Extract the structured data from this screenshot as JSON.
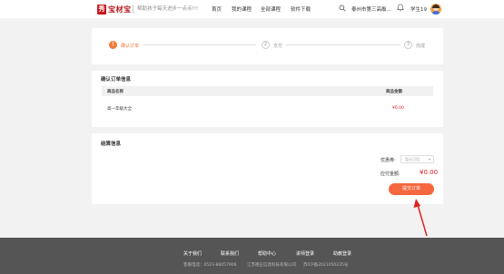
{
  "header": {
    "logo_mark": "秀",
    "logo_text": "宝材宝",
    "slogan": "帮助孩子每天进步一点点!!!",
    "nav": [
      "首页",
      "我的课程",
      "全部课程",
      "软件下载"
    ],
    "school": "泰州市第三高级...",
    "username": "学生19"
  },
  "steps": [
    {
      "num": "1",
      "label": "确认订单"
    },
    {
      "num": "2",
      "label": "支付"
    },
    {
      "num": "3",
      "label": "完成"
    }
  ],
  "confirm": {
    "title": "确认订单信息",
    "col_name": "商品名称",
    "col_amount": "商品金额",
    "rows": [
      {
        "name": "高一年级大全",
        "amount": "¥0.00"
      }
    ]
  },
  "settle": {
    "title": "结算信息",
    "coupon_label": "优惠券:",
    "coupon_placeholder": "暂无可用",
    "due_label": "应付金额:",
    "due_amount": "¥0.00",
    "submit_label": "提交订单"
  },
  "footer": {
    "links": [
      "关于我们",
      "联系我们",
      "帮助中心",
      "讲师登录",
      "助教登录"
    ],
    "phone": "客服电话：0523-86057906",
    "company": "江苏德正信息科技有限公司",
    "icp": "苏ICP备2021050235号"
  },
  "colors": {
    "accent": "#f5673e",
    "step_active": "#f07c3b",
    "price": "#e02020",
    "footer_bg": "#555555",
    "arrow": "#e02020"
  }
}
